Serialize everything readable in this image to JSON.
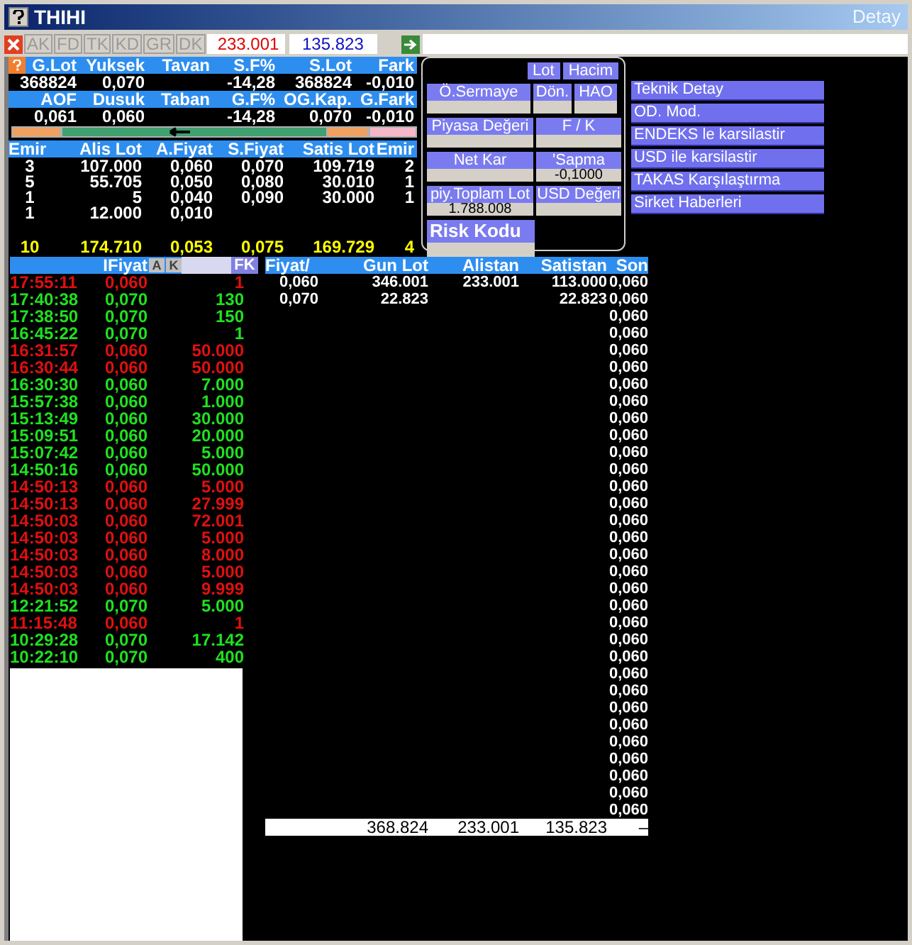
{
  "window": {
    "title": "THIHI",
    "detail": "Detay"
  },
  "toolbar": {
    "buttons": [
      "AK",
      "FD",
      "TK",
      "KD",
      "GR",
      "DK"
    ],
    "value_1": "233.001",
    "value_2": "135.823"
  },
  "summary": [
    [
      {
        "label": "G.Lot",
        "value": "368824"
      },
      {
        "label": "Yuksek",
        "value": "0,070"
      },
      {
        "label": "Tavan"
      },
      {
        "label": "S.F%",
        "value": "-14,28"
      },
      {
        "label": "S.Lot",
        "value": "368824"
      },
      {
        "label": "Fark",
        "value": "-0,010"
      }
    ],
    [
      {
        "label": "AOF",
        "value": "0,061"
      },
      {
        "label": "Dusuk",
        "value": "0,060"
      },
      {
        "label": "Taban"
      },
      {
        "label": "G.F%",
        "value": "-14,28"
      },
      {
        "label": "OG.Kap.",
        "value": "0,070"
      },
      {
        "label": "G.Fark",
        "value": "-0,010"
      }
    ]
  ],
  "order_book": {
    "columns": [
      "Emir",
      "Alis Lot",
      "A.Fiyat",
      "S.Fiyat",
      "Satis Lot",
      "Emir"
    ],
    "rows": [
      [
        "3",
        "107.000",
        "0,060",
        "0,070",
        "109.719",
        "2"
      ],
      [
        "5",
        "55.705",
        "0,050",
        "0,080",
        "30.010",
        "1"
      ],
      [
        "1",
        "5",
        "0,040",
        "0,090",
        "30.000",
        "1"
      ],
      [
        "1",
        "12.000",
        "0,010"
      ]
    ],
    "totals": [
      "10",
      "174.710",
      "0,053",
      "0,075",
      "169.729",
      "4"
    ]
  },
  "panel": {
    "buttons": [
      "Lot",
      "Hacim"
    ],
    "rows": [
      [
        {
          "label": "Ö.Sermaye"
        },
        {
          "label": "Dön."
        },
        {
          "label": "HAO"
        }
      ],
      [
        {
          "label": "Piyasa Değeri"
        },
        {
          "label": "F / K"
        }
      ],
      [
        {
          "label": "Net Kar"
        },
        {
          "label": "'Sapma",
          "value": "-0,1000"
        }
      ],
      [
        {
          "label": "piy.Toplam Lot",
          "value": "1.788.008"
        },
        {
          "label": "USD Değeri"
        }
      ],
      [
        {
          "label": "Risk Kodu"
        }
      ]
    ]
  },
  "links": [
    "Teknik Detay",
    "OD. Mod.",
    "ENDEKS le karsilastir",
    "USD ile karsilastir",
    "TAKAS Karşılaştırma",
    "Sirket Haberleri"
  ],
  "trades": {
    "title": "IFiyat",
    "buttons": [
      "A",
      "K"
    ],
    "fk": "FK",
    "rows": [
      {
        "time": "17:55:11",
        "price": "0,060",
        "lot": "1",
        "kind": "down"
      },
      {
        "time": "17:40:38",
        "price": "0,070",
        "lot": "130",
        "kind": "up"
      },
      {
        "time": "17:38:50",
        "price": "0,070",
        "lot": "150",
        "kind": "up"
      },
      {
        "time": "16:45:22",
        "price": "0,070",
        "lot": "1",
        "kind": "up"
      },
      {
        "time": "16:31:57",
        "price": "0,060",
        "lot": "50.000",
        "kind": "down"
      },
      {
        "time": "16:30:44",
        "price": "0,060",
        "lot": "50.000",
        "kind": "down"
      },
      {
        "time": "16:30:30",
        "price": "0,060",
        "lot": "7.000",
        "kind": "up"
      },
      {
        "time": "15:57:38",
        "price": "0,060",
        "lot": "1.000",
        "kind": "up"
      },
      {
        "time": "15:13:49",
        "price": "0,060",
        "lot": "30.000",
        "kind": "up"
      },
      {
        "time": "15:09:51",
        "price": "0,060",
        "lot": "20.000",
        "kind": "up"
      },
      {
        "time": "15:07:42",
        "price": "0,060",
        "lot": "5.000",
        "kind": "up"
      },
      {
        "time": "14:50:16",
        "price": "0,060",
        "lot": "50.000",
        "kind": "up"
      },
      {
        "time": "14:50:13",
        "price": "0,060",
        "lot": "5.000",
        "kind": "down"
      },
      {
        "time": "14:50:13",
        "price": "0,060",
        "lot": "27.999",
        "kind": "down"
      },
      {
        "time": "14:50:03",
        "price": "0,060",
        "lot": "72.001",
        "kind": "down"
      },
      {
        "time": "14:50:03",
        "price": "0,060",
        "lot": "5.000",
        "kind": "down"
      },
      {
        "time": "14:50:03",
        "price": "0,060",
        "lot": "8.000",
        "kind": "down"
      },
      {
        "time": "14:50:03",
        "price": "0,060",
        "lot": "5.000",
        "kind": "down"
      },
      {
        "time": "14:50:03",
        "price": "0,060",
        "lot": "9.999",
        "kind": "down"
      },
      {
        "time": "12:21:52",
        "price": "0,070",
        "lot": "5.000",
        "kind": "up"
      },
      {
        "time": "11:15:48",
        "price": "0,060",
        "lot": "1",
        "kind": "down"
      },
      {
        "time": "10:29:28",
        "price": "0,070",
        "lot": "17.142",
        "kind": "up"
      },
      {
        "time": "10:22:10",
        "price": "0,070",
        "lot": "400",
        "kind": "up"
      }
    ]
  },
  "table": {
    "columns": [
      "Fiyat/",
      "Gun Lot",
      "Alistan",
      "Satistan",
      "Son"
    ],
    "rows": [
      [
        "0,060",
        "346.001",
        "233.001",
        "113.000",
        "0,060"
      ],
      [
        "0,070",
        "22.823",
        null,
        "22.823",
        "0,060"
      ],
      [
        null,
        null,
        null,
        null,
        "0,060"
      ],
      [
        null,
        null,
        null,
        null,
        "0,060"
      ],
      [
        null,
        null,
        null,
        null,
        "0,060"
      ],
      [
        null,
        null,
        null,
        null,
        "0,060"
      ],
      [
        null,
        null,
        null,
        null,
        "0,060"
      ],
      [
        null,
        null,
        null,
        null,
        "0,060"
      ],
      [
        null,
        null,
        null,
        null,
        "0,060"
      ],
      [
        null,
        null,
        null,
        null,
        "0,060"
      ],
      [
        null,
        null,
        null,
        null,
        "0,060"
      ],
      [
        null,
        null,
        null,
        null,
        "0,060"
      ],
      [
        null,
        null,
        null,
        null,
        "0,060"
      ],
      [
        null,
        null,
        null,
        null,
        "0,060"
      ],
      [
        null,
        null,
        null,
        null,
        "0,060"
      ],
      [
        null,
        null,
        null,
        null,
        "0,060"
      ],
      [
        null,
        null,
        null,
        null,
        "0,060"
      ],
      [
        null,
        null,
        null,
        null,
        "0,060"
      ],
      [
        null,
        null,
        null,
        null,
        "0,060"
      ],
      [
        null,
        null,
        null,
        null,
        "0,060"
      ],
      [
        null,
        null,
        null,
        null,
        "0,060"
      ],
      [
        null,
        null,
        null,
        null,
        "0,060"
      ],
      [
        null,
        null,
        null,
        null,
        "0,060"
      ],
      [
        null,
        null,
        null,
        null,
        "0,060"
      ],
      [
        null,
        null,
        null,
        null,
        "0,060"
      ],
      [
        null,
        null,
        null,
        null,
        "0,060"
      ],
      [
        null,
        null,
        null,
        null,
        "0,060"
      ],
      [
        null,
        null,
        null,
        null,
        "0,060"
      ],
      [
        null,
        null,
        null,
        null,
        "0,060"
      ],
      [
        null,
        null,
        null,
        null,
        "0,060"
      ],
      [
        null,
        null,
        null,
        null,
        "0,060"
      ],
      [
        null,
        null,
        null,
        null,
        "0,060"
      ]
    ],
    "totals": [
      "368.824",
      "233.001",
      "135.823",
      "–"
    ]
  }
}
